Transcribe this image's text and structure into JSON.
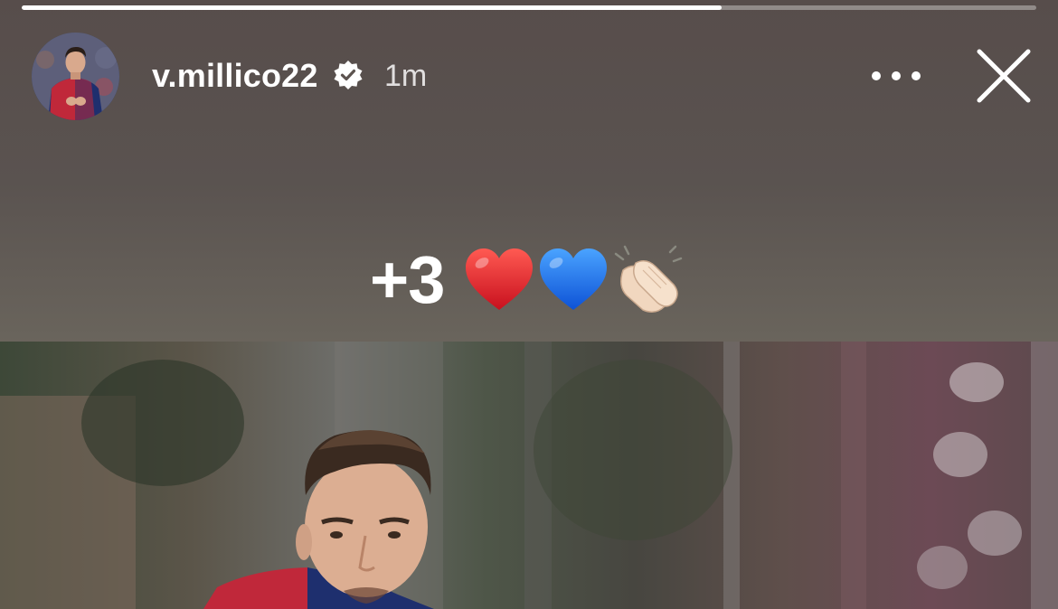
{
  "story": {
    "progress": 0.69,
    "username": "v.millico22",
    "verified": true,
    "time_ago": "1m",
    "caption": "+3",
    "emojis": [
      "red-heart",
      "blue-heart",
      "clapping-hands"
    ]
  },
  "colors": {
    "background": "#5c534f",
    "text": "#ffffff",
    "jersey_red": "#c0283a",
    "jersey_blue": "#1e2f6e"
  }
}
